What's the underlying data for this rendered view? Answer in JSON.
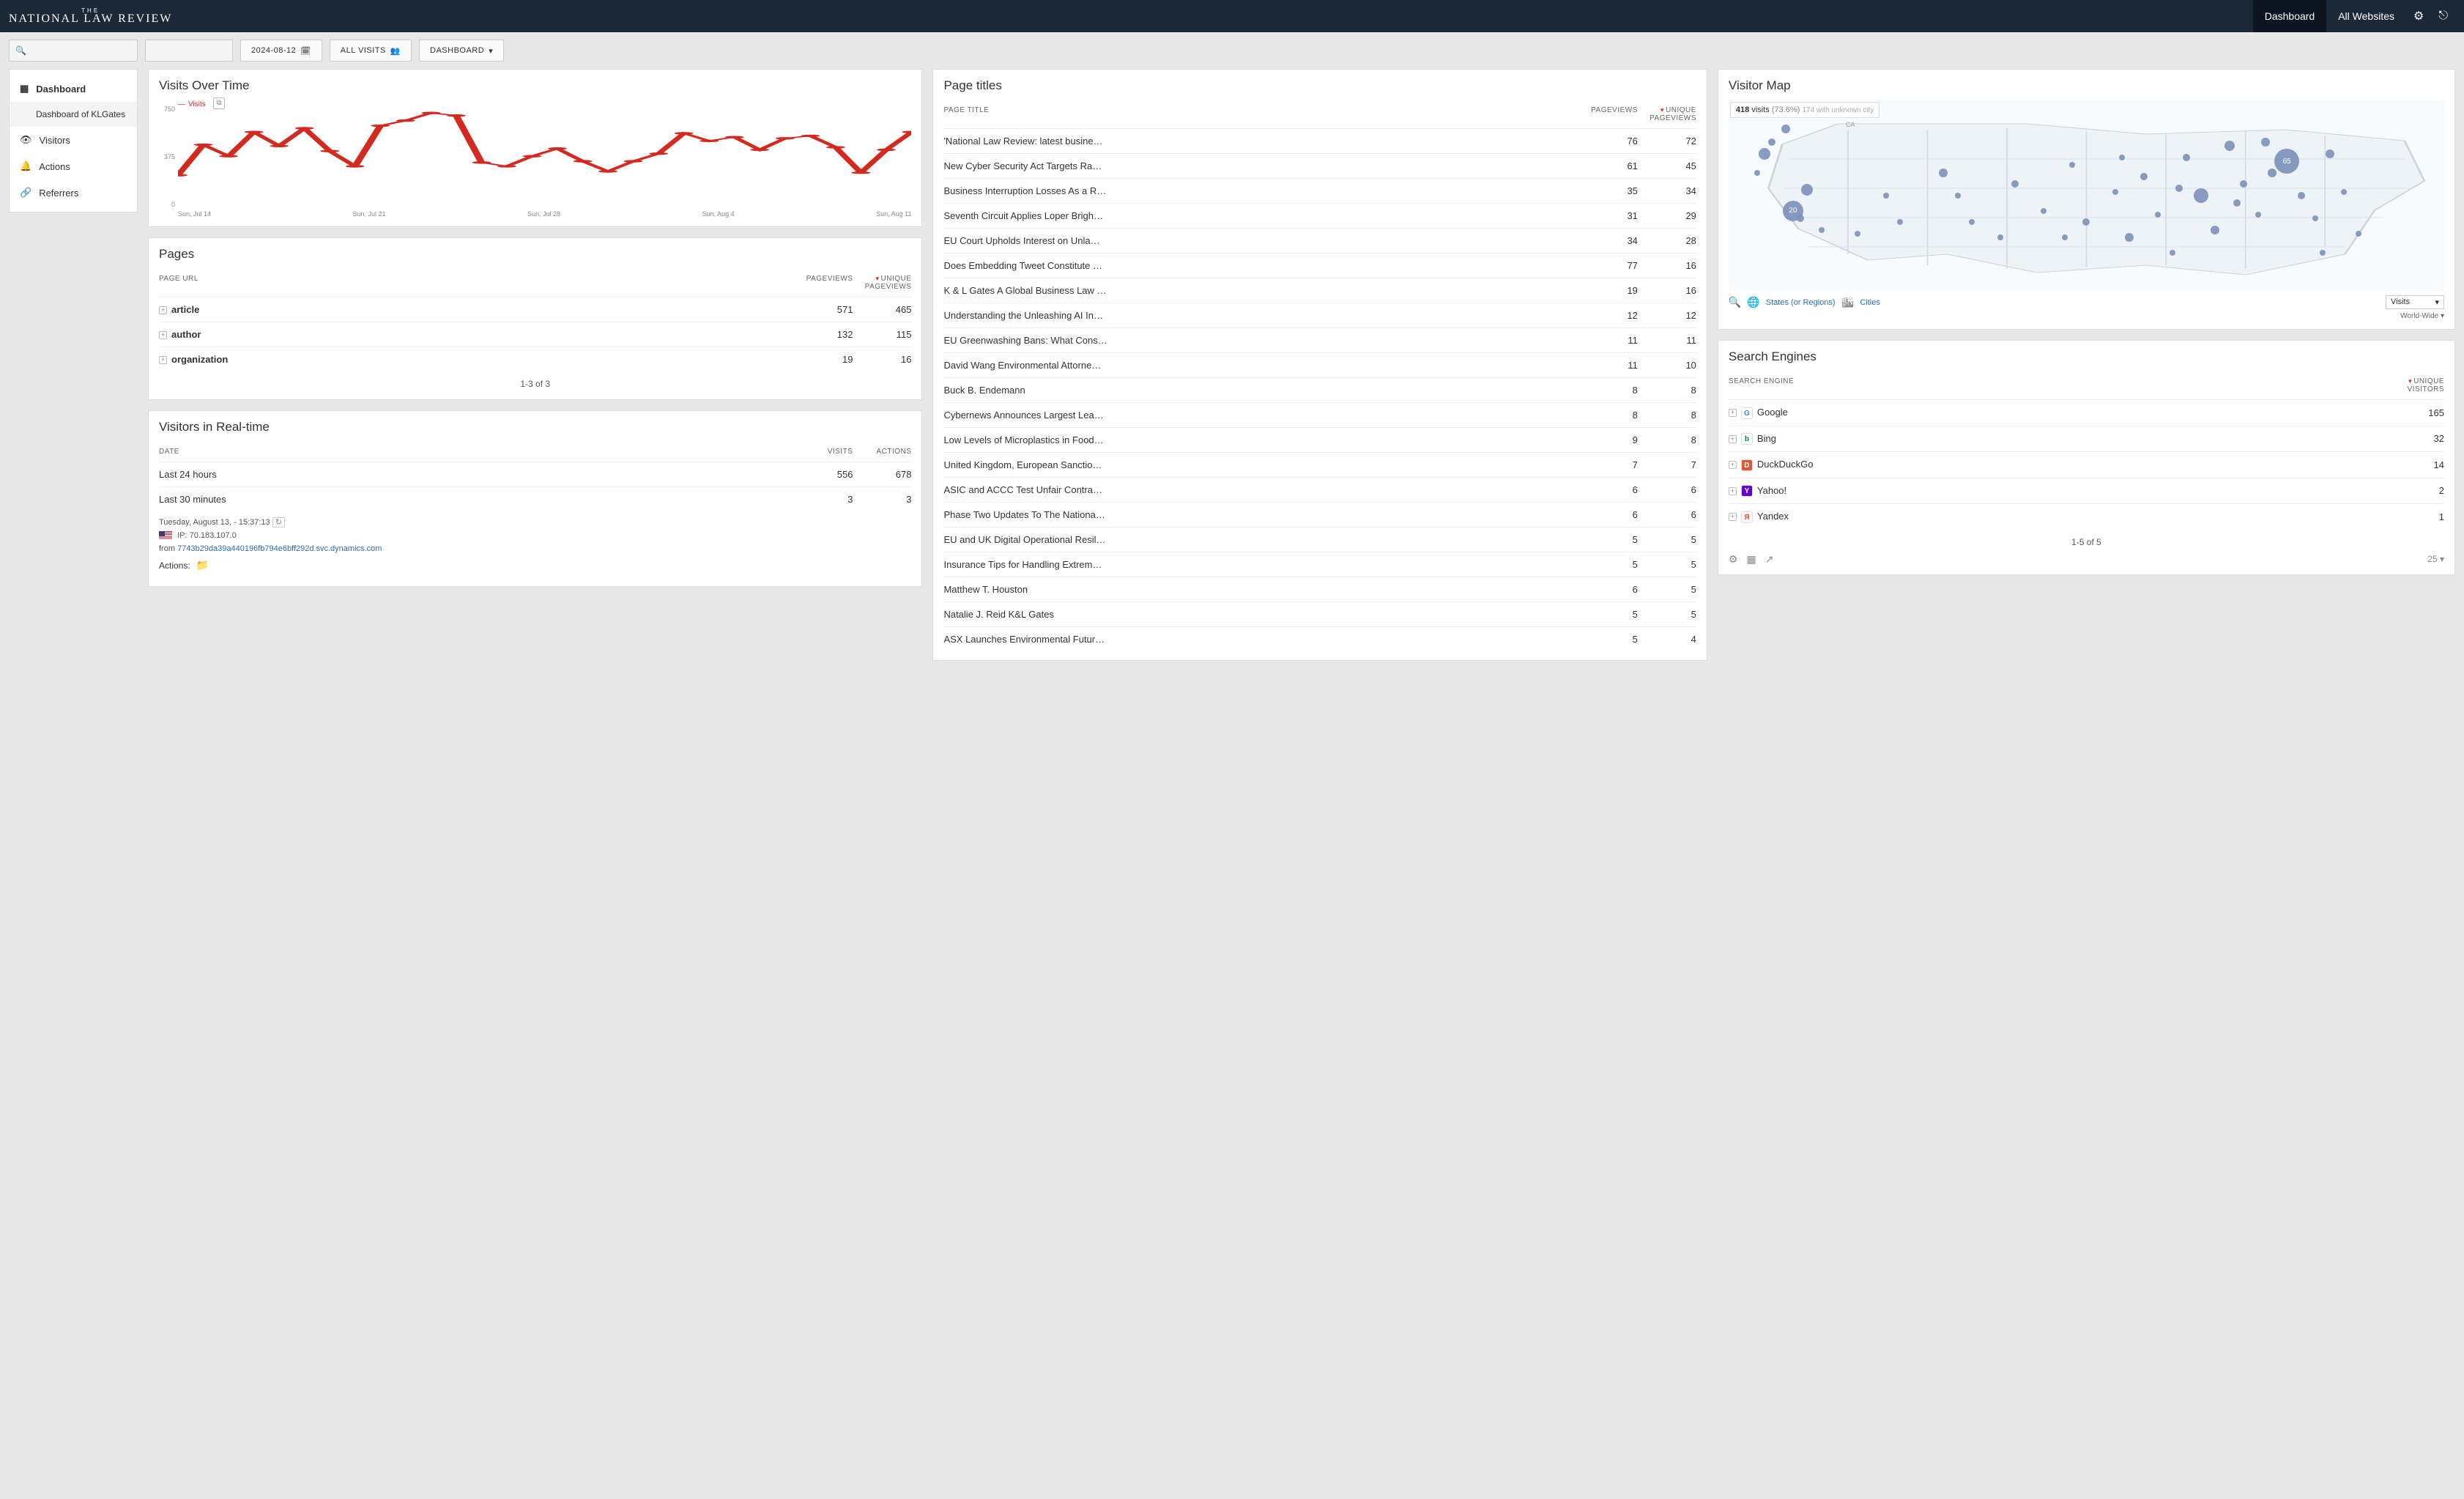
{
  "brand": {
    "small": "THE",
    "title": "NATIONAL LAW REVIEW"
  },
  "topnav": {
    "dashboard": "Dashboard",
    "all_websites": "All Websites"
  },
  "toolbar": {
    "date": "2024-08-12",
    "segment": "ALL VISITS",
    "view": "DASHBOARD"
  },
  "sidebar": {
    "items": [
      {
        "label": "Dashboard",
        "sub": "Dashboard of KLGates"
      },
      {
        "label": "Visitors"
      },
      {
        "label": "Actions"
      },
      {
        "label": "Referrers"
      }
    ]
  },
  "visits_over_time": {
    "title": "Visits Over Time",
    "legend": "Visits",
    "y_ticks": [
      "750",
      "375",
      "0"
    ],
    "x_ticks": [
      "Sun, Jul 14",
      "Sun, Jul 21",
      "Sun, Jul 28",
      "Sun, Aug 4",
      "Sun, Aug 11"
    ]
  },
  "chart_data": {
    "type": "line",
    "title": "Visits Over Time",
    "ylabel": "Visits",
    "ylim": [
      0,
      750
    ],
    "series": [
      {
        "name": "Visits",
        "color": "#d4291f",
        "x": [
          "Jul 14",
          "Jul 15",
          "Jul 16",
          "Jul 17",
          "Jul 18",
          "Jul 19",
          "Jul 20",
          "Jul 21",
          "Jul 22",
          "Jul 23",
          "Jul 24",
          "Jul 25",
          "Jul 26",
          "Jul 27",
          "Jul 28",
          "Jul 29",
          "Jul 30",
          "Jul 31",
          "Aug 1",
          "Aug 2",
          "Aug 3",
          "Aug 4",
          "Aug 5",
          "Aug 6",
          "Aug 7",
          "Aug 8",
          "Aug 9",
          "Aug 10",
          "Aug 11",
          "Aug 12"
        ],
        "values": [
          230,
          470,
          380,
          570,
          460,
          600,
          420,
          300,
          620,
          660,
          720,
          700,
          330,
          300,
          380,
          440,
          340,
          260,
          340,
          400,
          560,
          500,
          530,
          430,
          520,
          540,
          450,
          250,
          430,
          570
        ]
      }
    ]
  },
  "pages": {
    "title": "Pages",
    "cols": {
      "url": "PAGE URL",
      "pv": "PAGEVIEWS",
      "upv": "UNIQUE PAGEVIEWS"
    },
    "rows": [
      {
        "url": "article",
        "pv": 571,
        "upv": 465
      },
      {
        "url": "author",
        "pv": 132,
        "upv": 115
      },
      {
        "url": "organization",
        "pv": 19,
        "upv": 16
      }
    ],
    "pager": "1-3 of 3"
  },
  "realtime": {
    "title": "Visitors in Real-time",
    "cols": {
      "date": "DATE",
      "visits": "VISITS",
      "actions": "ACTIONS"
    },
    "rows": [
      {
        "date": "Last 24 hours",
        "visits": 556,
        "actions": 678
      },
      {
        "date": "Last 30 minutes",
        "visits": 3,
        "actions": 3
      }
    ],
    "detail_time": "Tuesday, August 13, - 15:37:13",
    "ip_label": "IP:",
    "ip": "70.183.107.0",
    "from_label": "from",
    "from_link": "7743b29da39a440196fb794e6bff292d.svc.dynamics.com",
    "actions_label": "Actions:"
  },
  "page_titles": {
    "title": "Page titles",
    "cols": {
      "title": "PAGE TITLE",
      "pv": "PAGEVIEWS",
      "upv": "UNIQUE PAGEVIEWS"
    },
    "rows": [
      {
        "t": "'National Law Review: latest busine…",
        "pv": 76,
        "upv": 72
      },
      {
        "t": "New Cyber Security Act Targets Ra…",
        "pv": 61,
        "upv": 45
      },
      {
        "t": "Business Interruption Losses As a R…",
        "pv": 35,
        "upv": 34
      },
      {
        "t": "Seventh Circuit Applies Loper Brigh…",
        "pv": 31,
        "upv": 29
      },
      {
        "t": "EU Court Upholds Interest on Unla…",
        "pv": 34,
        "upv": 28
      },
      {
        "t": "Does Embedding Tweet Constitute …",
        "pv": 77,
        "upv": 16
      },
      {
        "t": "K & L Gates A Global Business Law …",
        "pv": 19,
        "upv": 16
      },
      {
        "t": "Understanding the Unleashing AI In…",
        "pv": 12,
        "upv": 12
      },
      {
        "t": "EU Greenwashing Bans: What Cons…",
        "pv": 11,
        "upv": 11
      },
      {
        "t": "David Wang Environmental Attorne…",
        "pv": 11,
        "upv": 10
      },
      {
        "t": "Buck B. Endemann",
        "pv": 8,
        "upv": 8
      },
      {
        "t": "Cybernews Announces Largest Lea…",
        "pv": 8,
        "upv": 8
      },
      {
        "t": "Low Levels of Microplastics in Food…",
        "pv": 9,
        "upv": 8
      },
      {
        "t": "United Kingdom, European Sanctio…",
        "pv": 7,
        "upv": 7
      },
      {
        "t": "ASIC and ACCC Test Unfair Contra…",
        "pv": 6,
        "upv": 6
      },
      {
        "t": "Phase Two Updates To The Nationa…",
        "pv": 6,
        "upv": 6
      },
      {
        "t": "EU and UK Digital Operational Resil…",
        "pv": 5,
        "upv": 5
      },
      {
        "t": "Insurance Tips for Handling Extrem…",
        "pv": 5,
        "upv": 5
      },
      {
        "t": "Matthew T. Houston",
        "pv": 6,
        "upv": 5
      },
      {
        "t": "Natalie J. Reid K&L Gates",
        "pv": 5,
        "upv": 5
      },
      {
        "t": "ASX Launches Environmental Futur…",
        "pv": 5,
        "upv": 4
      }
    ]
  },
  "visitor_map": {
    "title": "Visitor Map",
    "summary_visits": "418",
    "summary_label": "visits",
    "summary_pct": "(73.6%)",
    "summary_unknown": "174 with unknown city",
    "ca_label": "CA",
    "bubbles_big": [
      {
        "x": 78,
        "y": 32,
        "r": 17,
        "n": "65"
      },
      {
        "x": 9,
        "y": 58,
        "r": 14,
        "n": "20"
      }
    ],
    "link_states": "States (or Regions)",
    "link_cities": "Cities",
    "metric": "Visits",
    "scope": "World-Wide"
  },
  "search_engines": {
    "title": "Search Engines",
    "cols": {
      "engine": "SEARCH ENGINE",
      "uv": "UNIQUE VISITORS"
    },
    "rows": [
      {
        "name": "Google",
        "uv": 165,
        "bg": "#fff",
        "fg": "#4285f4",
        "letter": "G"
      },
      {
        "name": "Bing",
        "uv": 32,
        "bg": "#fff",
        "fg": "#008272",
        "letter": "b"
      },
      {
        "name": "DuckDuckGo",
        "uv": 14,
        "bg": "#de5833",
        "fg": "#fff",
        "letter": "D"
      },
      {
        "name": "Yahoo!",
        "uv": 2,
        "bg": "#5f01d1",
        "fg": "#fff",
        "letter": "Y"
      },
      {
        "name": "Yandex",
        "uv": 1,
        "bg": "#fff",
        "fg": "#fc3f1d",
        "letter": "Я"
      }
    ],
    "pager": "1-5 of 5",
    "page_size": "25"
  }
}
